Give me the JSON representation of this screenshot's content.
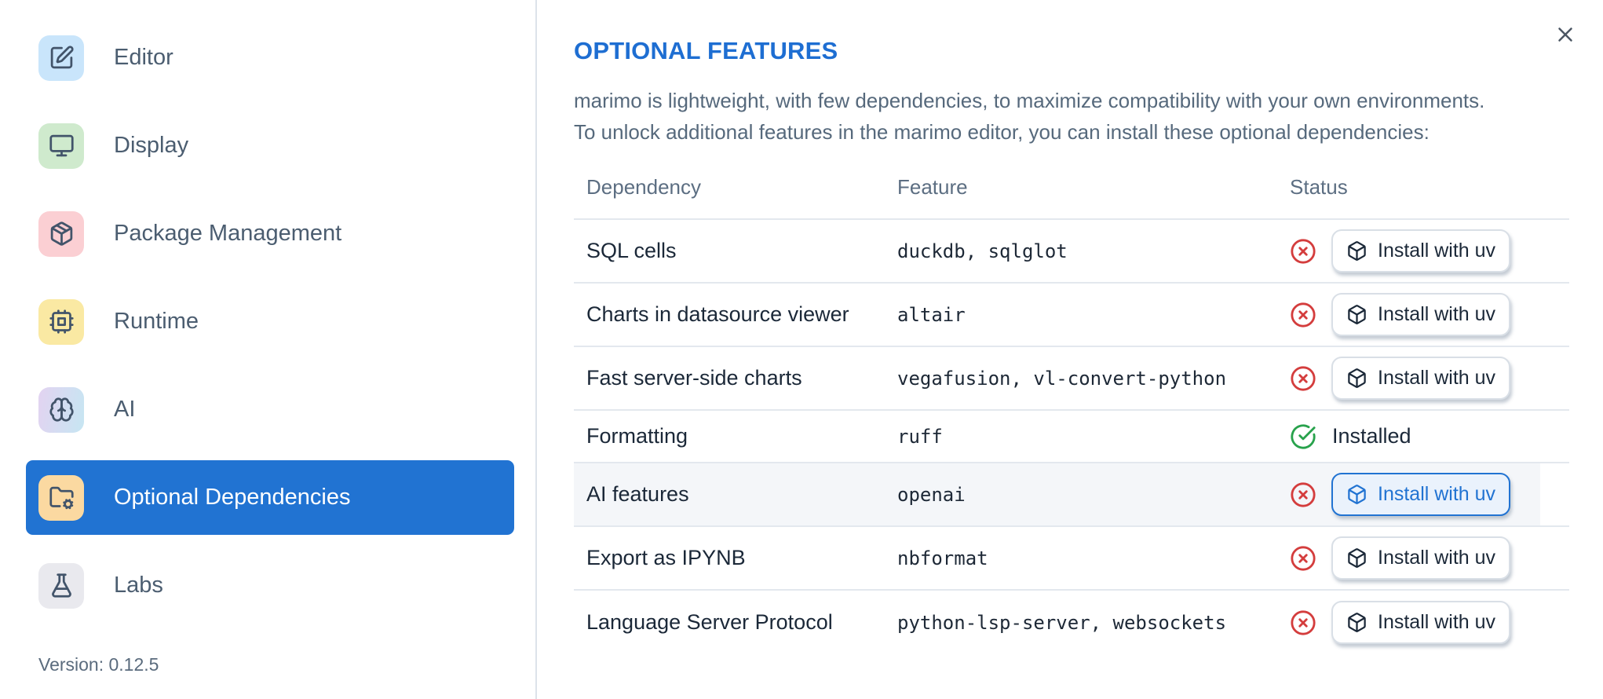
{
  "colors": {
    "accent": "#2173d2",
    "error": "#d43d3d",
    "success": "#28a24c",
    "title": "#1e6ed2"
  },
  "sidebar": {
    "items": [
      {
        "label": "Editor",
        "icon": "square-pen-icon",
        "icon_bg": "#c9e5fb",
        "selected": false
      },
      {
        "label": "Display",
        "icon": "monitor-icon",
        "icon_bg": "#cfeacd",
        "selected": false
      },
      {
        "label": "Package Management",
        "icon": "package-icon",
        "icon_bg": "#fbcfd3",
        "selected": false
      },
      {
        "label": "Runtime",
        "icon": "cpu-icon",
        "icon_bg": "#fae9a3",
        "selected": false
      },
      {
        "label": "AI",
        "icon": "brain-icon",
        "icon_bg": "linear-gradient(100deg,#e3d3f1,#c6e6f2)",
        "selected": false
      },
      {
        "label": "Optional Dependencies",
        "icon": "folder-cog-icon",
        "icon_bg": "#fbd9a1",
        "selected": true
      },
      {
        "label": "Labs",
        "icon": "flask-icon",
        "icon_bg": "#e9e9ee",
        "selected": false
      }
    ],
    "version_label": "Version: 0.12.5"
  },
  "panel": {
    "title": "OPTIONAL FEATURES",
    "description_line1": "marimo is lightweight, with few dependencies, to maximize compatibility with your own environments.",
    "description_line2": "To unlock additional features in the marimo editor, you can install these optional dependencies:",
    "table": {
      "columns": [
        "Dependency",
        "Feature",
        "Status"
      ],
      "rows": [
        {
          "dependency": "SQL cells",
          "feature": "duckdb, sqlglot",
          "installed": false,
          "action": "Install with uv",
          "highlighted": false
        },
        {
          "dependency": "Charts in datasource viewer",
          "feature": "altair",
          "installed": false,
          "action": "Install with uv",
          "highlighted": false
        },
        {
          "dependency": "Fast server-side charts",
          "feature": "vegafusion, vl-convert-python",
          "installed": false,
          "action": "Install with uv",
          "highlighted": false
        },
        {
          "dependency": "Formatting",
          "feature": "ruff",
          "installed": true,
          "status_label": "Installed",
          "highlighted": false
        },
        {
          "dependency": "AI features",
          "feature": "openai",
          "installed": false,
          "action": "Install with uv",
          "highlighted": true
        },
        {
          "dependency": "Export as IPYNB",
          "feature": "nbformat",
          "installed": false,
          "action": "Install with uv",
          "highlighted": false
        },
        {
          "dependency": "Language Server Protocol",
          "feature": "python-lsp-server, websockets",
          "installed": false,
          "action": "Install with uv",
          "highlighted": false
        }
      ]
    }
  }
}
